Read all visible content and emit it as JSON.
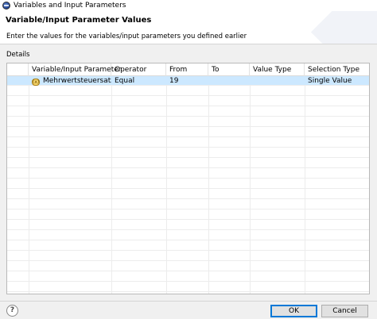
{
  "window": {
    "title": "Variables and Input Parameters"
  },
  "header": {
    "title": "Variable/Input Parameter Values",
    "description": "Enter the values for the variables/input parameters you defined earlier"
  },
  "details": {
    "label": "Details",
    "columns": [
      "Variable/Input Parameter",
      "Operator",
      "From",
      "To",
      "Value Type",
      "Selection Type"
    ],
    "rows": [
      {
        "variable": "Mehrwertsteuersatz*",
        "operator": "Equal",
        "from": "19",
        "to": "",
        "value_type": "",
        "selection_type": "Single Value",
        "icon": "variable-icon"
      }
    ]
  },
  "buttons": {
    "ok": "OK",
    "cancel": "Cancel",
    "help": "?"
  }
}
